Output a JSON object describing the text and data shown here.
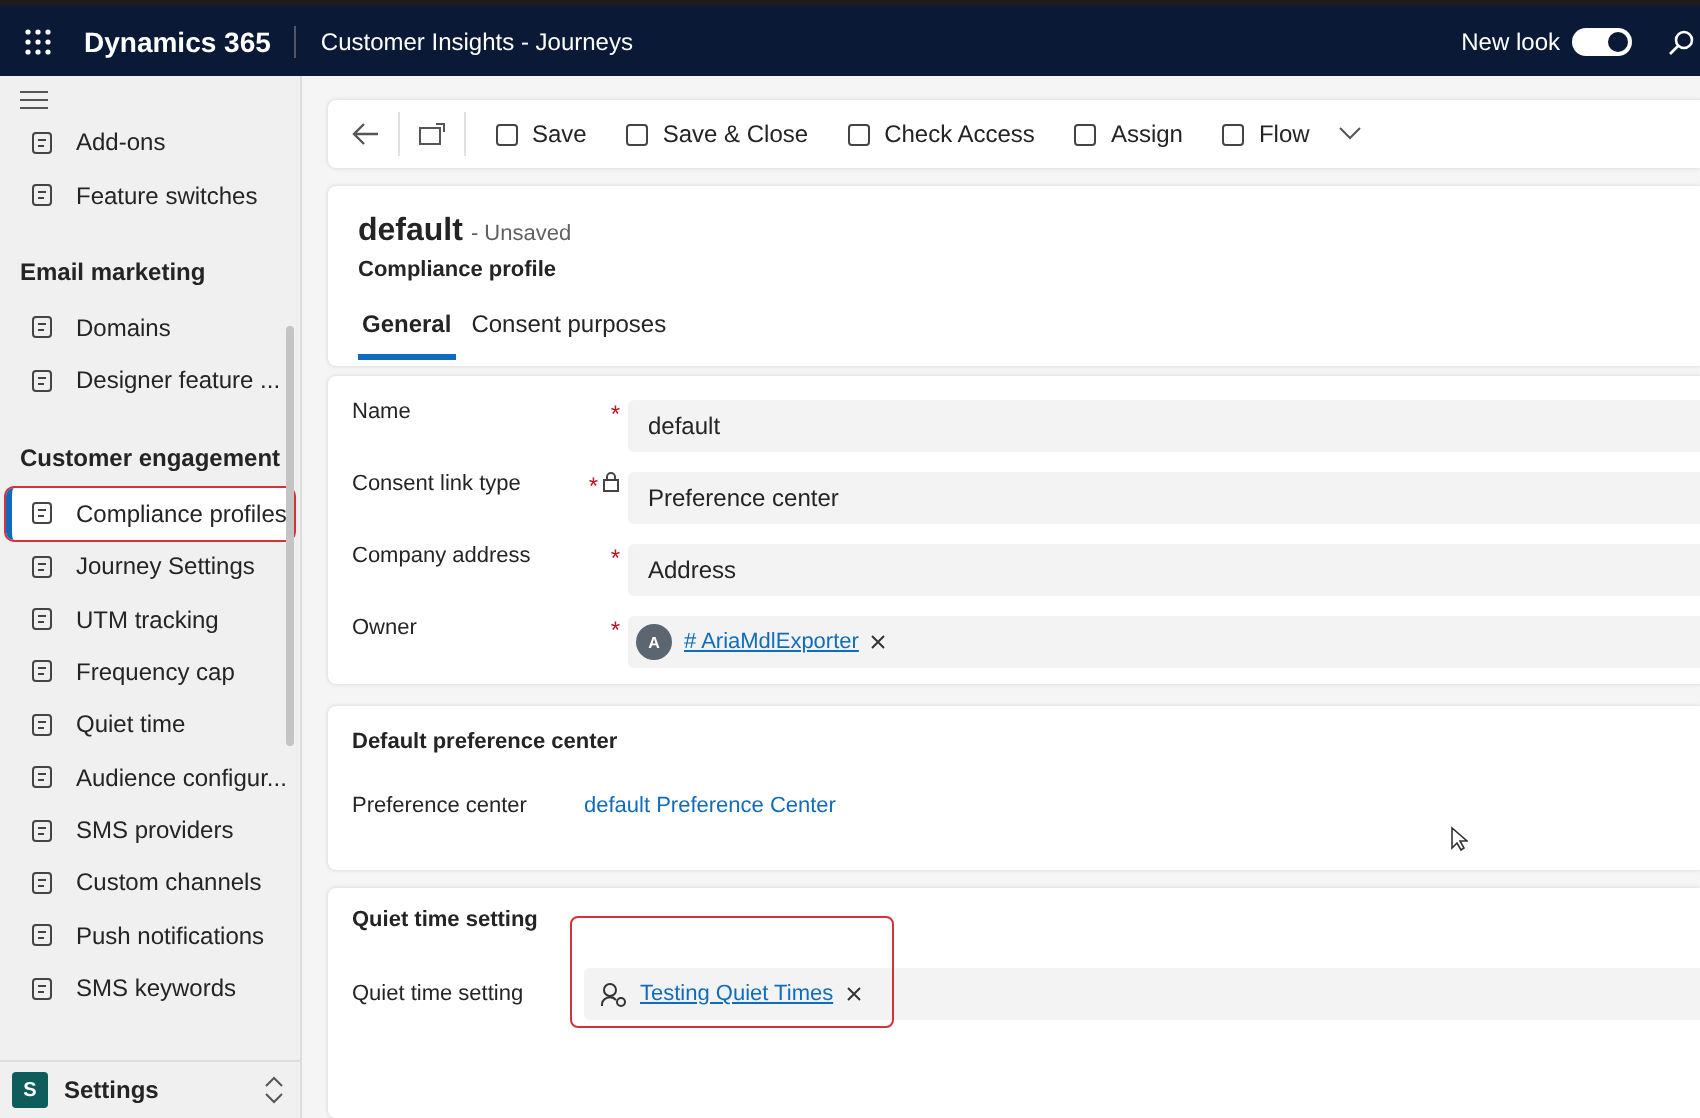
{
  "header": {
    "app": "Dynamics 365",
    "area": "Customer Insights - Journeys",
    "new_look": {
      "label": "New look",
      "on": true
    }
  },
  "sidebar": {
    "sections": [
      {
        "items": [
          {
            "label": "Add-ons",
            "selected": false
          },
          {
            "label": "Feature switches",
            "selected": false
          }
        ]
      },
      {
        "title": "Email marketing",
        "items": [
          {
            "label": "Domains",
            "selected": false
          },
          {
            "label": "Designer feature ...",
            "selected": false
          }
        ]
      },
      {
        "title": "Customer engagement",
        "items": [
          {
            "label": "Compliance profiles",
            "selected": true,
            "highlighted": true
          },
          {
            "label": "Journey Settings",
            "selected": false
          },
          {
            "label": "UTM tracking",
            "selected": false
          },
          {
            "label": "Frequency cap",
            "selected": false
          },
          {
            "label": "Quiet time",
            "selected": false
          },
          {
            "label": "Audience configur...",
            "selected": false
          },
          {
            "label": "SMS providers",
            "selected": false
          },
          {
            "label": "Custom channels",
            "selected": false
          },
          {
            "label": "Push notifications",
            "selected": false
          },
          {
            "label": "SMS keywords",
            "selected": false
          }
        ]
      }
    ],
    "area_switcher": {
      "badge": "S",
      "label": "Settings"
    }
  },
  "toolbar": [
    "Save",
    "Save & Close",
    "Check Access",
    "Assign",
    "Flow"
  ],
  "record": {
    "title": "default",
    "status": "- Unsaved",
    "entity": "Compliance profile",
    "tabs": [
      {
        "label": "General",
        "selected": true
      },
      {
        "label": "Consent purposes",
        "selected": false
      }
    ]
  },
  "fields": [
    {
      "kind": "text",
      "label": "Name",
      "required_mark": "*",
      "value": "default"
    },
    {
      "kind": "text",
      "label": "Consent link type",
      "required_mark": "*",
      "locked": true,
      "value": "Preference center"
    },
    {
      "kind": "text",
      "label": "Company address",
      "required_mark": "*",
      "value": "Address"
    },
    {
      "kind": "lookup",
      "label": "Owner",
      "required_mark": "*",
      "avatar": "A",
      "value": "# AriaMdlExporter"
    }
  ],
  "preference_section": {
    "title": "Default preference center",
    "label": "Preference center",
    "link": "default Preference Center"
  },
  "quiet_section": {
    "title": "Quiet time setting",
    "label": "Quiet time setting",
    "value": "Testing Quiet Times",
    "highlighted": true
  }
}
